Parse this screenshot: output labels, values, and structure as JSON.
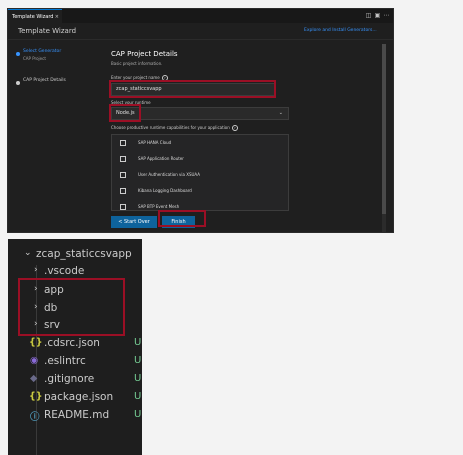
{
  "wizard": {
    "tab_label": "Template Wizard",
    "tab_close": "×",
    "title": "Template Wizard",
    "link": "Explore and Install Generators...",
    "steps": [
      {
        "label": "Select Generator",
        "sub": "CAP Project"
      },
      {
        "label": "CAP Project Details"
      }
    ],
    "form": {
      "heading": "CAP Project Details",
      "subheading": "Basic project information.",
      "name_label": "Enter your project name",
      "name_value": "zcap_staticcsvapp",
      "runtime_label": "Select your runtime",
      "runtime_value": "Node.js",
      "capabilities_label": "Choose productive runtime capabilities for your application",
      "capabilities": [
        "SAP HANA Cloud",
        "SAP Application Router",
        "User Authentication via XSUAA",
        "Kibana Logging Dashboard",
        "SAP BTP Event Mesh"
      ],
      "start_over": "< Start Over",
      "finish": "Finish"
    }
  },
  "explorer": {
    "root": "zcap_staticcsvapp",
    "items": [
      {
        "name": ".vscode",
        "type": "folder"
      },
      {
        "name": "app",
        "type": "folder"
      },
      {
        "name": "db",
        "type": "folder"
      },
      {
        "name": "srv",
        "type": "folder"
      },
      {
        "name": ".cdsrc.json",
        "type": "json",
        "status": "U"
      },
      {
        "name": ".eslintrc",
        "type": "eslint",
        "status": "U"
      },
      {
        "name": ".gitignore",
        "type": "git",
        "status": "U"
      },
      {
        "name": "package.json",
        "type": "json",
        "status": "U"
      },
      {
        "name": "README.md",
        "type": "info",
        "status": "U"
      }
    ]
  },
  "colors": {
    "highlight": "#9b0f25",
    "accent": "#0e639c",
    "git_untracked": "#73c991",
    "json_icon": "#cbcb41",
    "eslint_icon": "#8a6ad8",
    "git_icon": "#6a6a8a",
    "info_icon": "#519aba"
  }
}
